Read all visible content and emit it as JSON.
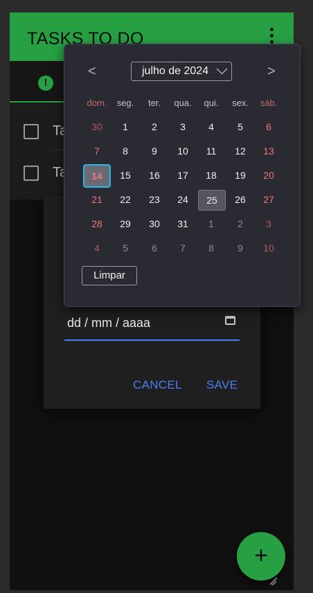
{
  "app": {
    "title": "TASKS TO DO",
    "tab_alert_glyph": "!",
    "tasks": [
      {
        "text": "Ta"
      },
      {
        "text": "Ta"
      }
    ],
    "fab_label": "+",
    "accent_color": "#27a044"
  },
  "dialog": {
    "date_placeholder": "dd / mm / aaaa",
    "cancel_label": "CANCEL",
    "save_label": "SAVE"
  },
  "calendar": {
    "prev_label": "<",
    "next_label": ">",
    "month_label": "julho de 2024",
    "weekdays": [
      "dom.",
      "seg.",
      "ter.",
      "qua.",
      "qui.",
      "sex.",
      "sáb."
    ],
    "weeks": [
      [
        "30",
        "1",
        "2",
        "3",
        "4",
        "5",
        "6"
      ],
      [
        "7",
        "8",
        "9",
        "10",
        "11",
        "12",
        "13"
      ],
      [
        "14",
        "15",
        "16",
        "17",
        "18",
        "19",
        "20"
      ],
      [
        "21",
        "22",
        "23",
        "24",
        "25",
        "26",
        "27"
      ],
      [
        "28",
        "29",
        "30",
        "31",
        "1",
        "2",
        "3"
      ],
      [
        "4",
        "5",
        "6",
        "7",
        "8",
        "9",
        "10"
      ]
    ],
    "today": "14",
    "selected": "25",
    "clear_label": "Limpar"
  }
}
